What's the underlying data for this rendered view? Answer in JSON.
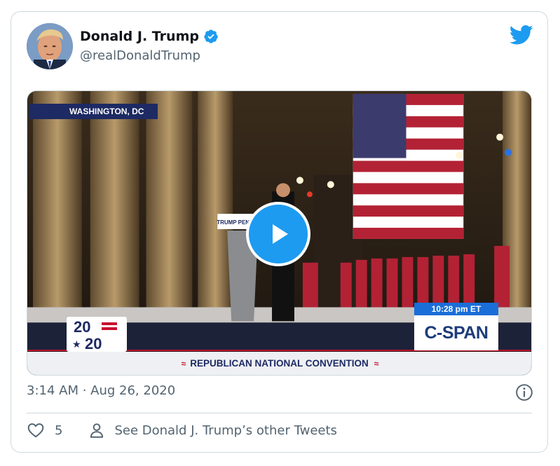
{
  "author": {
    "display_name": "Donald J. Trump",
    "handle": "@realDonaldTrump",
    "verified": true,
    "avatar_icon": "avatar-photo",
    "brand_icon": "twitter-bird-icon",
    "brand_color": "#1d9bf0"
  },
  "media": {
    "location": "WASHINGTON, DC",
    "podium_text": "TRUMP PENCE",
    "badge_top": "20",
    "badge_bottom": "20",
    "network_time": "10:28 pm ET",
    "network_logo": "C-SPAN",
    "ticker": "REPUBLICAN NATIONAL CONVENTION",
    "play_icon": "play-icon"
  },
  "meta": {
    "timestamp": "3:14 AM · Aug 26, 2020",
    "info_icon": "info-icon"
  },
  "actions": {
    "like_count": "5",
    "other_tweets_label": "See Donald J. Trump’s other Tweets"
  }
}
